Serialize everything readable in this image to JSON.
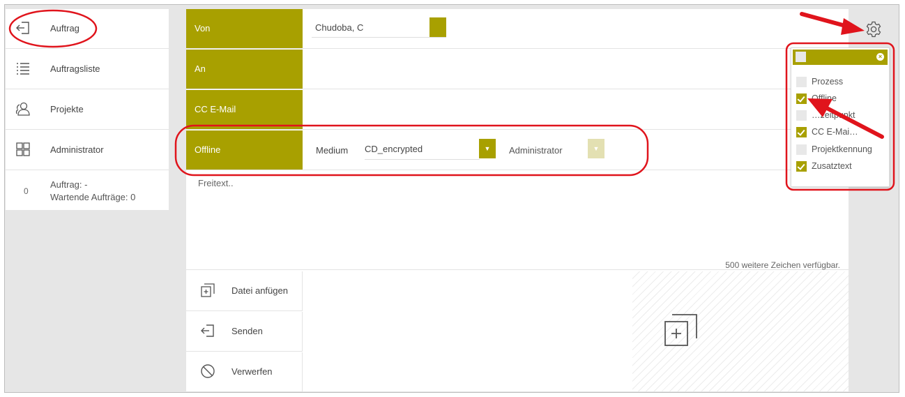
{
  "sidebar": {
    "items": [
      {
        "label": "Auftrag",
        "icon": "sign-in-icon"
      },
      {
        "label": "Auftragsliste",
        "icon": "list-icon"
      },
      {
        "label": "Projekte",
        "icon": "users-icon"
      },
      {
        "label": "Administrator",
        "icon": "grid-icon"
      }
    ],
    "status": {
      "count": "0",
      "line1": "Auftrag: -",
      "line2": "Wartende Aufträge: 0"
    }
  },
  "form": {
    "von_label": "Von",
    "von_value": "Chudoba, C",
    "an_label": "An",
    "cc_label": "CC E-Mail",
    "offline_label": "Offline",
    "medium_label": "Medium",
    "medium_value": "CD_encrypted",
    "admin_label": "Administrator",
    "freetext_placeholder": "Freitext..",
    "char_count": "500 weitere Zeichen verfügbar."
  },
  "actions": {
    "attach": "Datei anfügen",
    "send": "Senden",
    "discard": "Verwerfen"
  },
  "dropdown": {
    "items": [
      {
        "label": "Prozess",
        "checked": false
      },
      {
        "label": "Offline",
        "checked": true
      },
      {
        "label": "…zeitpunkt",
        "checked": false
      },
      {
        "label": "CC E-Mai…",
        "checked": true
      },
      {
        "label": "Projektkennung",
        "checked": false
      },
      {
        "label": "Zusatztext",
        "checked": true
      }
    ]
  },
  "colors": {
    "accent": "#a8a000",
    "annotation": "#e0141c"
  }
}
